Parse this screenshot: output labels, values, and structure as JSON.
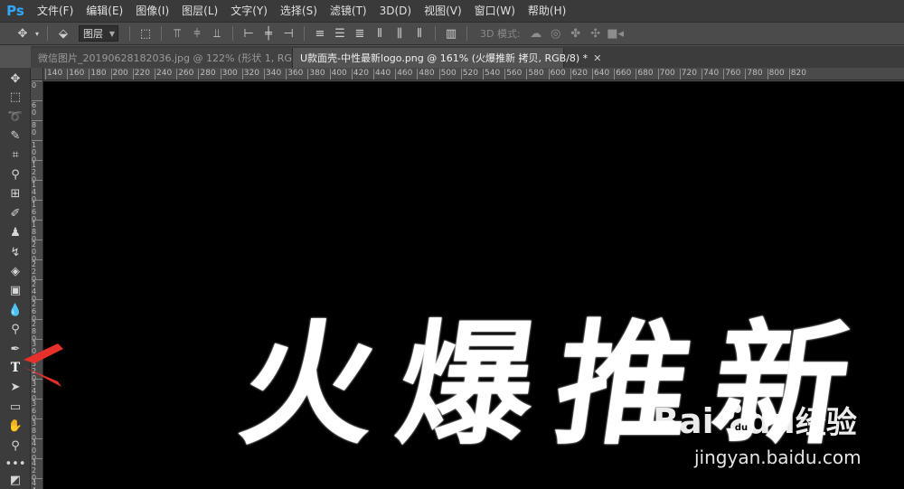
{
  "app": {
    "logo": "Ps"
  },
  "menu": [
    "文件(F)",
    "编辑(E)",
    "图像(I)",
    "图层(L)",
    "文字(Y)",
    "选择(S)",
    "滤镜(T)",
    "3D(D)",
    "视图(V)",
    "窗口(W)",
    "帮助(H)"
  ],
  "options": {
    "layer_select": "图层",
    "mode_3d_label": "3D 模式:"
  },
  "tabs": [
    {
      "label": "微信图片_20190628182036.jpg @ 122% (形状 1, RGB/8) *",
      "active": false
    },
    {
      "label": "U款面壳-中性最新logo.png @ 161% (火爆推新 拷贝, RGB/8) *",
      "active": true
    }
  ],
  "ruler_top": [
    "140",
    "160",
    "180",
    "200",
    "220",
    "240",
    "260",
    "280",
    "300",
    "320",
    "340",
    "360",
    "380",
    "400",
    "420",
    "440",
    "460",
    "480",
    "500",
    "520",
    "540",
    "560",
    "580",
    "600",
    "620",
    "640",
    "660",
    "680",
    "700",
    "720",
    "740",
    "760",
    "780",
    "800",
    "820"
  ],
  "ruler_left": [
    "0",
    "60",
    "80",
    "100",
    "120",
    "140",
    "160",
    "180",
    "200",
    "220",
    "240",
    "260",
    "280",
    "300",
    "320",
    "340",
    "360",
    "380",
    "400",
    "420",
    "440"
  ],
  "canvas": {
    "headline": "火爆推新"
  },
  "watermark": {
    "brand": "Bai",
    "brand2": "du",
    "product": "经验",
    "url": "jingyan.baidu.com"
  },
  "colors": {
    "accent_arrow": "#e8302b",
    "ps_blue": "#31a8ff"
  }
}
